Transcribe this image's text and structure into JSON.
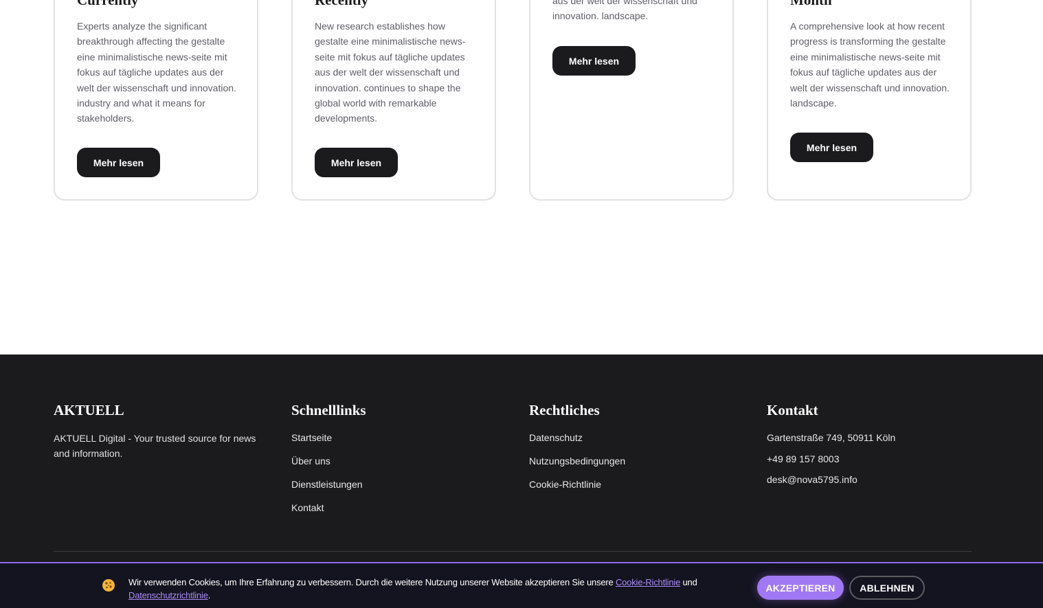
{
  "cards": [
    {
      "title": "Currently",
      "text": "Experts analyze the significant breakthrough affecting the gestalte eine minimalistische news-seite mit fokus auf tägliche updates aus der welt der wissenschaft und innovation. industry and what it means for stakeholders.",
      "button": "Mehr lesen"
    },
    {
      "title": "Recently",
      "text": "New research establishes how gestalte eine minimalistische news-seite mit fokus auf tägliche updates aus der welt der wissenschaft und innovation. continues to shape the global world with remarkable developments.",
      "button": "Mehr lesen"
    },
    {
      "title": "",
      "text": "aus der welt der wissenschaft und innovation. landscape.",
      "button": "Mehr lesen"
    },
    {
      "title": "Month",
      "text": "A comprehensive look at how recent progress is transforming the gestalte eine minimalistische news-seite mit fokus auf tägliche updates aus der welt der wissenschaft und innovation. landscape.",
      "button": "Mehr lesen"
    }
  ],
  "footer": {
    "brand": {
      "title": "AKTUELL",
      "description": "AKTUELL Digital - Your trusted source for news and information."
    },
    "quicklinks": {
      "title": "Schnelllinks",
      "items": [
        "Startseite",
        "Über uns",
        "Dienstleistungen",
        "Kontakt"
      ]
    },
    "legal": {
      "title": "Rechtliches",
      "items": [
        "Datenschutz",
        "Nutzungsbedingungen",
        "Cookie-Richtlinie"
      ]
    },
    "contact": {
      "title": "Kontakt",
      "address": "Gartenstraße 749, 50911 Köln",
      "phone": "+49 89 157 8003",
      "email": "desk@nova5795.info"
    }
  },
  "cookie": {
    "text_before": "Wir verwenden Cookies, um Ihre Erfahrung zu verbessern. Durch die weitere Nutzung unserer Website akzeptieren Sie unsere ",
    "link_cookie": "Cookie-Richtlinie",
    "text_middle": " und ",
    "link_privacy": "Datenschutzrichtlinie",
    "text_after": ".",
    "accept": "AKZEPTIEREN",
    "decline": "ABLEHNEN",
    "accent_color": "#a178f3"
  }
}
